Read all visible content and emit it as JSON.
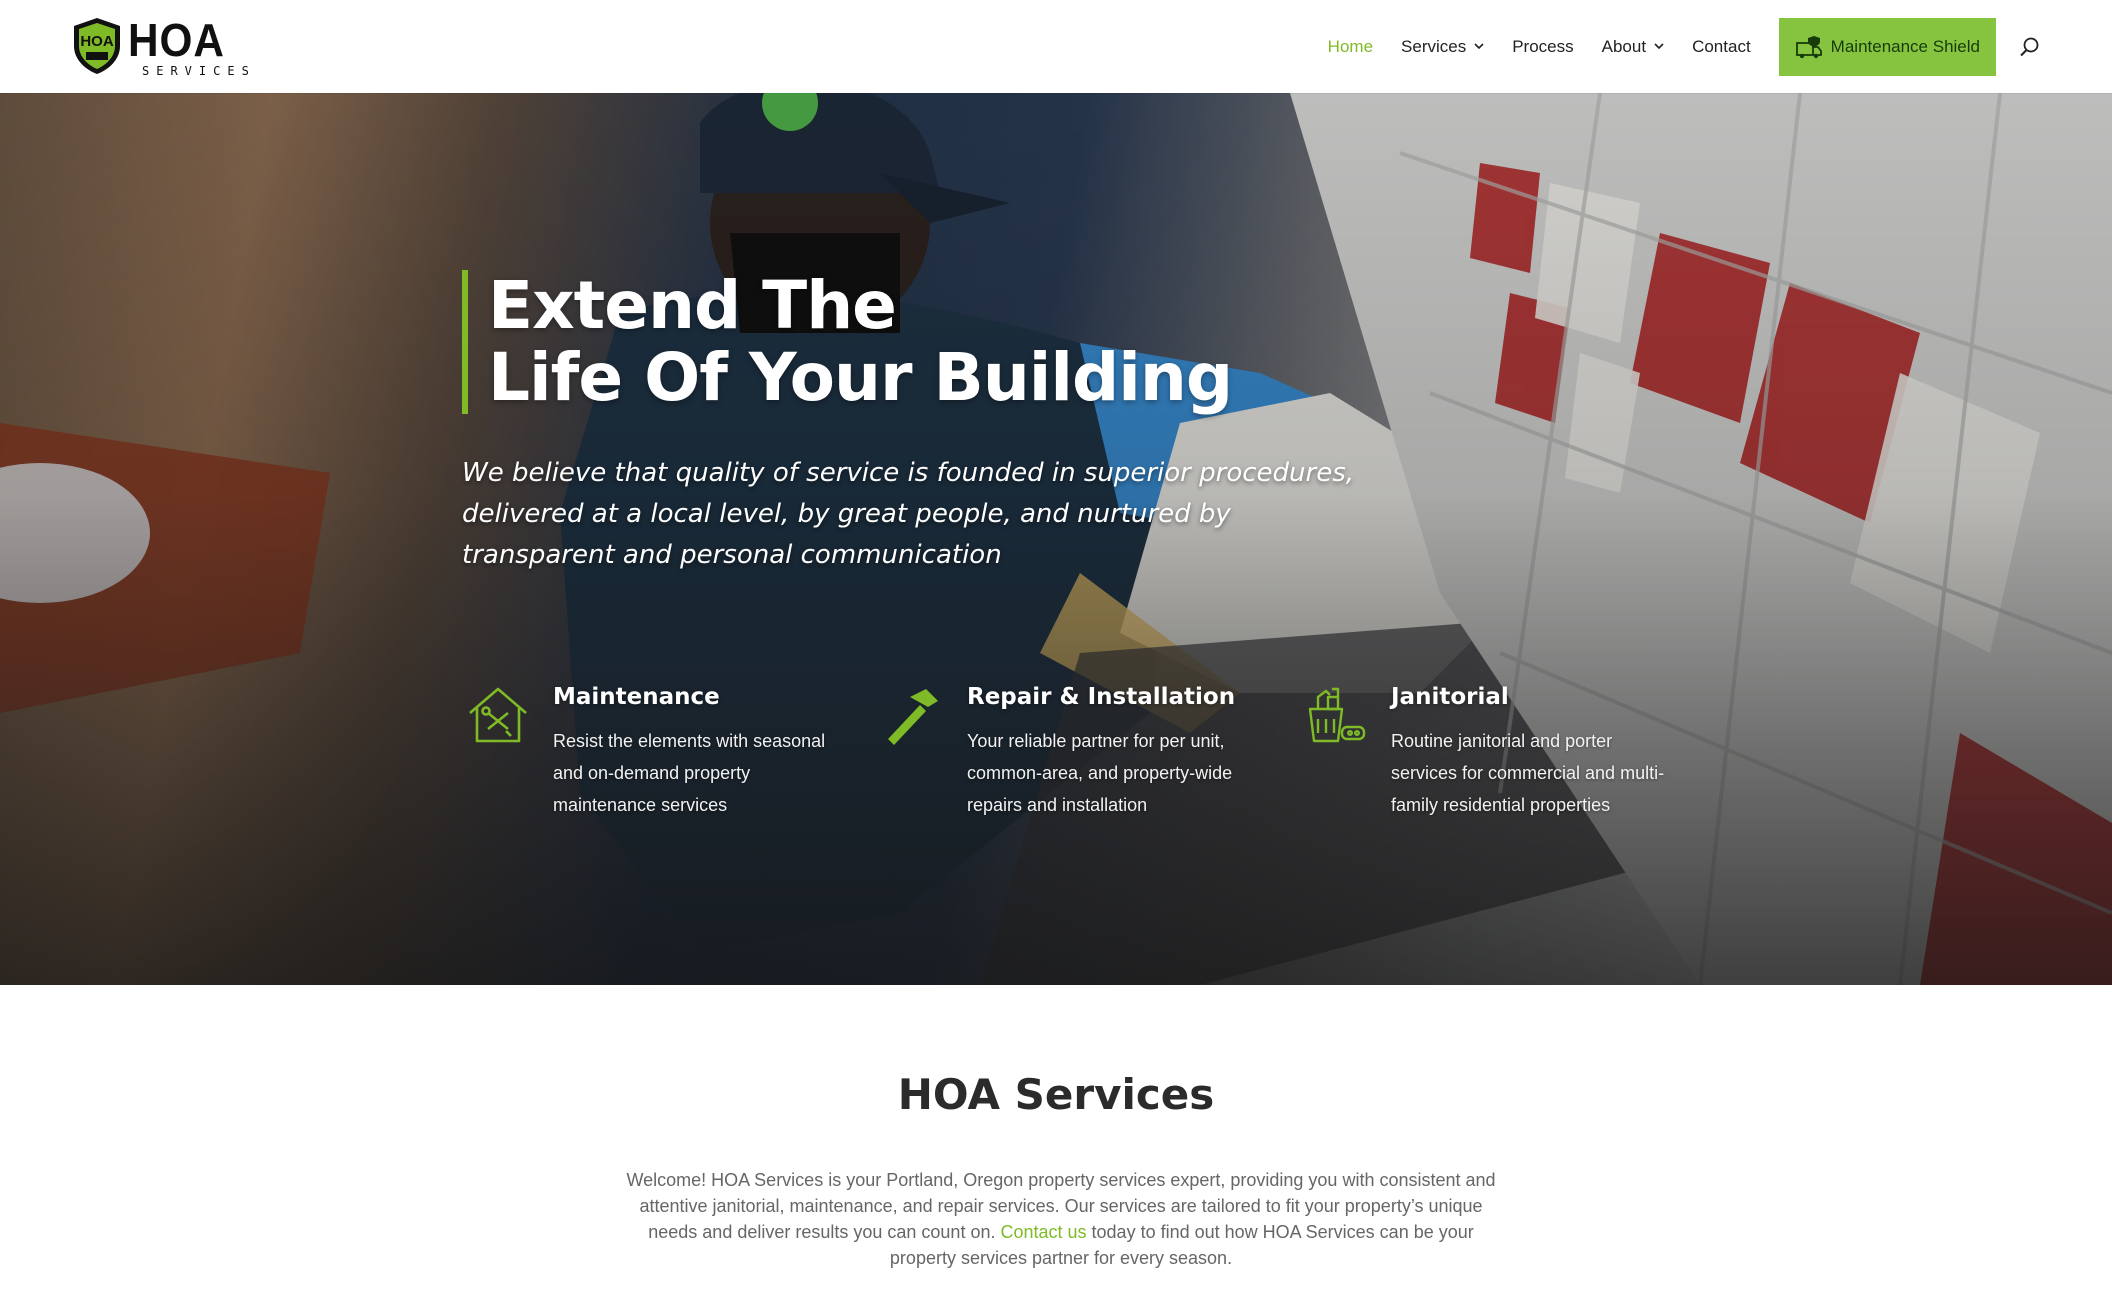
{
  "brand": {
    "name": "HOA",
    "subtitle": "SERVICES",
    "badge_text": "HOA",
    "badge_subtext": "SERVICES"
  },
  "nav": {
    "items": [
      {
        "label": "Home",
        "active": true,
        "has_dropdown": false
      },
      {
        "label": "Services",
        "active": false,
        "has_dropdown": true
      },
      {
        "label": "Process",
        "active": false,
        "has_dropdown": false
      },
      {
        "label": "About",
        "active": false,
        "has_dropdown": true
      },
      {
        "label": "Contact",
        "active": false,
        "has_dropdown": false
      }
    ],
    "cta_label": "Maintenance Shield",
    "cta_icon": "truck-shield-icon",
    "search_icon": "search-icon"
  },
  "hero": {
    "title_line1": "Extend The",
    "title_line2": "Life Of Your Building",
    "subtitle": "We believe that quality of service is founded in superior procedures, delivered at a local level, by great people, and nurtured by transparent and personal communication"
  },
  "features": [
    {
      "icon": "house-tools-icon",
      "title": "Maintenance",
      "text": "Resist the elements with seasonal and on-demand property maintenance services"
    },
    {
      "icon": "hammer-icon",
      "title": "Repair & Installation",
      "text": "Your reliable partner for per unit, common-area, and property-wide repairs and installation"
    },
    {
      "icon": "cleaning-supplies-icon",
      "title": "Janitorial",
      "text": "Routine janitorial and porter services for commercial and multi-family residential properties"
    }
  ],
  "services": {
    "title": "HOA Services",
    "intro_before": "Welcome! HOA Services is your Portland, Oregon property services expert, providing you with consistent and attentive janitorial, maintenance, and repair services. Our services are tailored to fit your property’s unique needs and deliver results you can count on. ",
    "intro_link": "Contact us",
    "intro_after": " today to find out how HOA Services can be your property services partner for every season."
  },
  "colors": {
    "accent": "#7fba27",
    "cta_bg": "#86c440",
    "heading": "#2b2b2b"
  }
}
